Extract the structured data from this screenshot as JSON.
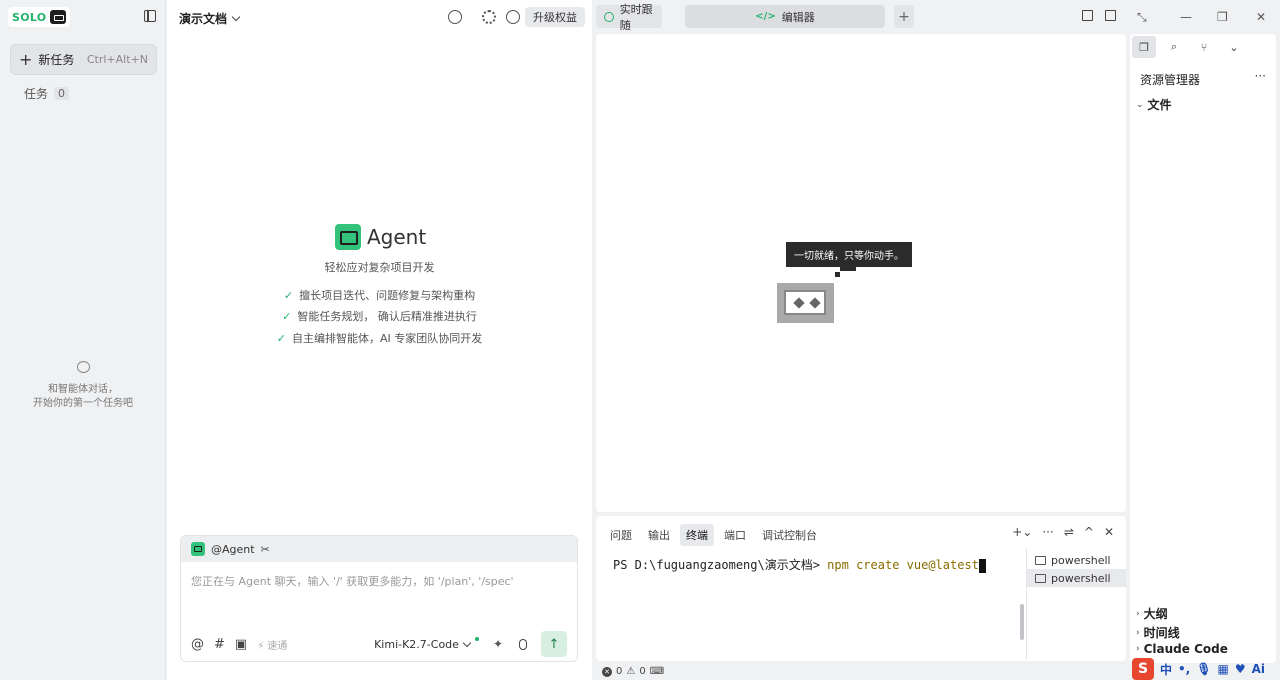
{
  "sidebar": {
    "logo_text": "SOLO",
    "new_task_label": "新任务",
    "new_task_shortcut": "Ctrl+Alt+N",
    "tasks_label": "任务",
    "tasks_count": "0",
    "empty_line1": "和智能体对话，",
    "empty_line2": "开始你的第一个任务吧"
  },
  "chat": {
    "doc_title": "演示文档",
    "upgrade_label": "升级权益",
    "agent_name": "Agent",
    "agent_subtitle": "轻松应对复杂项目开发",
    "features": [
      "擅长项目迭代、问题修复与架构重构",
      "智能任务规划，  确认后精准推进执行",
      "自主编排智能体，AI 专家团队协同开发"
    ],
    "composer": {
      "mention": "@Agent",
      "placeholder": "您正在与 Agent 聊天，输入 '/' 获取更多能力，如 '/plan', '/spec'",
      "speed_label": "速通",
      "model": "Kimi-K2.7-Code"
    }
  },
  "topbar": {
    "tab_live": "实时跟随",
    "tab_editor": "编辑器",
    "tab_add": "+"
  },
  "editor": {
    "bubble_text": "一切就绪，只等你动手。"
  },
  "terminal": {
    "tabs": [
      "问题",
      "输出",
      "终端",
      "端口",
      "调试控制台"
    ],
    "active_tab": "终端",
    "prompt": "PS D:\\fuguangzaomeng\\演示文档> ",
    "command": "npm create vue@latest",
    "shells": [
      "powershell",
      "powershell"
    ]
  },
  "statusbar": {
    "errors": "0",
    "warnings": "0"
  },
  "explorer": {
    "title": "资源管理器",
    "section_files": "文件",
    "section_outline": "大纲",
    "section_timeline": "时间线",
    "section_claude": "Claude Code"
  },
  "tray": {
    "ime_mode": "中",
    "ai_label": "Ai"
  }
}
